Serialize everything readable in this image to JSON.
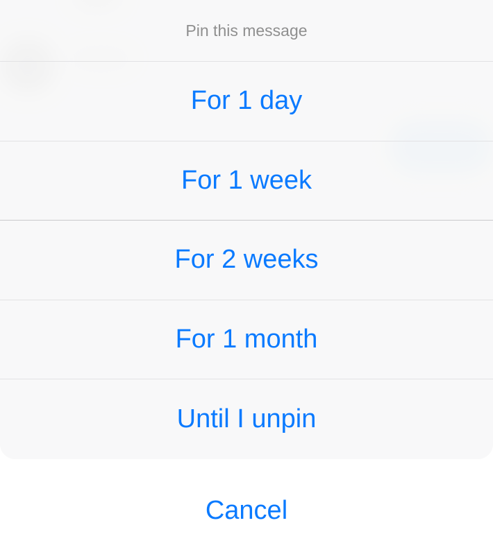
{
  "sheet": {
    "title": "Pin this message",
    "options": [
      {
        "label": "For 1 day"
      },
      {
        "label": "For 1 week"
      },
      {
        "label": "For 2 weeks"
      },
      {
        "label": "For 1 month"
      },
      {
        "label": "Until I unpin"
      }
    ],
    "cancel_label": "Cancel"
  },
  "colors": {
    "accent": "#0a7aff",
    "title_text": "#8f8f8f",
    "sheet_background": "#f9f9f9"
  }
}
